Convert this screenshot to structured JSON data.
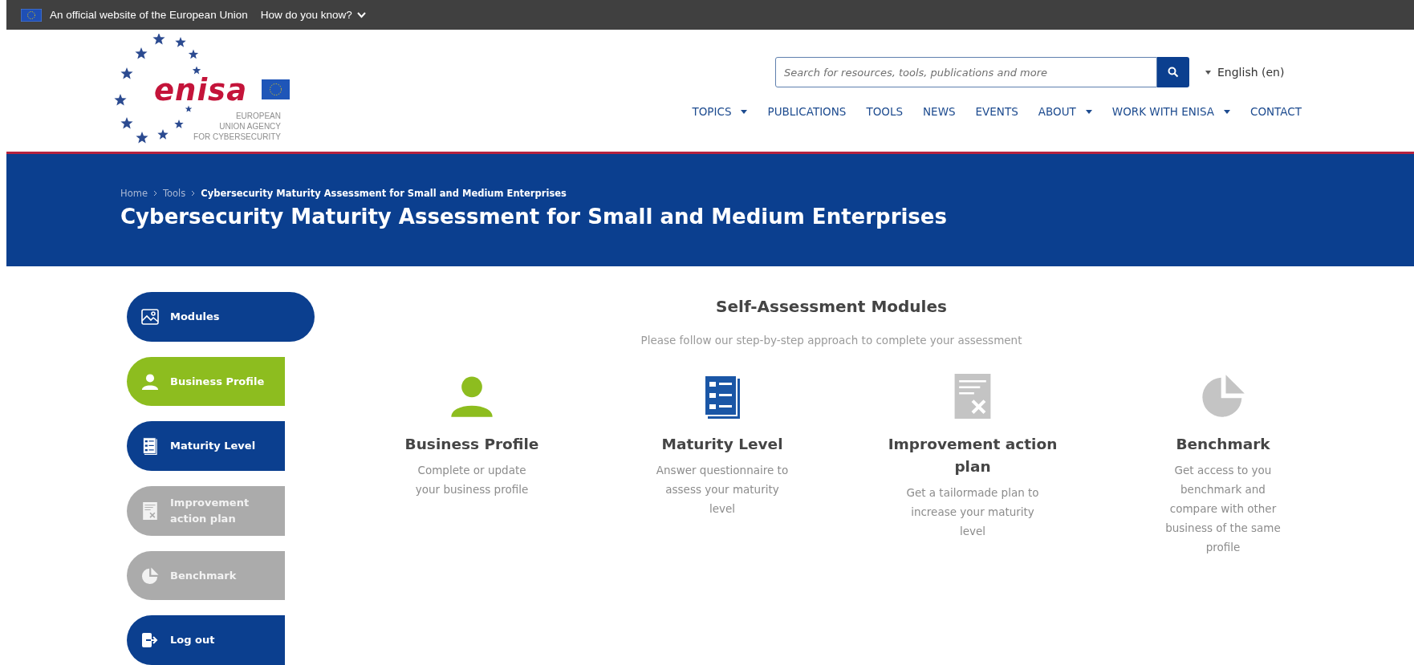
{
  "eu_bar": {
    "text": "An official website of the European Union",
    "link": "How do you know?"
  },
  "logo": {
    "wordmark": "enisa",
    "tagline": [
      "EUROPEAN",
      "UNION AGENCY",
      "FOR CYBERSECURITY"
    ]
  },
  "search": {
    "placeholder": "Search for resources, tools, publications and more"
  },
  "language": "English (en)",
  "nav": [
    {
      "label": "TOPICS",
      "dropdown": true
    },
    {
      "label": "PUBLICATIONS",
      "dropdown": false
    },
    {
      "label": "TOOLS",
      "dropdown": false
    },
    {
      "label": "NEWS",
      "dropdown": false
    },
    {
      "label": "EVENTS",
      "dropdown": false
    },
    {
      "label": "ABOUT",
      "dropdown": true
    },
    {
      "label": "WORK WITH ENISA",
      "dropdown": true
    },
    {
      "label": "CONTACT",
      "dropdown": false
    }
  ],
  "breadcrumb": [
    {
      "label": "Home",
      "current": false
    },
    {
      "label": "Tools",
      "current": false
    },
    {
      "label": "Cybersecurity Maturity Assessment for Small and Medium Enterprises",
      "current": true
    }
  ],
  "page_title": "Cybersecurity Maturity Assessment for Small and Medium Enterprises",
  "sidebar": {
    "items": [
      {
        "label": "Modules",
        "kind": "modules",
        "selected": false,
        "disabled": false
      },
      {
        "label": "Business Profile",
        "kind": "profile",
        "selected": true,
        "disabled": false
      },
      {
        "label": "Maturity Level",
        "kind": "checklist",
        "selected": false,
        "disabled": false
      },
      {
        "label": "Improvement action plan",
        "kind": "plan",
        "selected": false,
        "disabled": true
      },
      {
        "label": "Benchmark",
        "kind": "pie",
        "selected": false,
        "disabled": true
      },
      {
        "label": "Log out",
        "kind": "logout",
        "selected": false,
        "disabled": false
      }
    ]
  },
  "modules": {
    "title": "Self-Assessment Modules",
    "subtitle": "Please follow our step-by-step approach to complete your assessment",
    "items": [
      {
        "title": "Business Profile",
        "description": "Complete or update your business profile",
        "kind": "profile",
        "selected": true,
        "disabled": false
      },
      {
        "title": "Maturity Level",
        "description": "Answer questionnaire to assess your maturity level",
        "kind": "checklist",
        "selected": false,
        "disabled": false
      },
      {
        "title": "Improvement action plan",
        "description": "Get a tailormade plan to increase your maturity level",
        "kind": "plan",
        "selected": false,
        "disabled": true
      },
      {
        "title": "Benchmark",
        "description": "Get access to you benchmark and compare with other business of the same profile",
        "kind": "pie",
        "selected": false,
        "disabled": true
      }
    ]
  }
}
